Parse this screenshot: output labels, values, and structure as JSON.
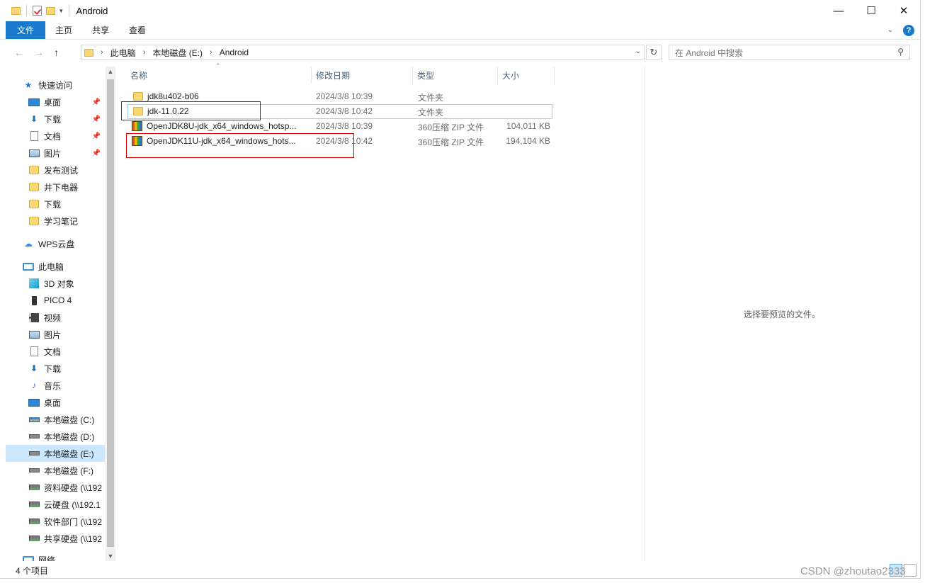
{
  "window": {
    "title": "Android",
    "controls": {
      "minimize": "—",
      "maximize": "☐",
      "close": "✕"
    }
  },
  "ribbon": {
    "tabs": [
      "文件",
      "主页",
      "共享",
      "查看"
    ],
    "help": "?"
  },
  "address": {
    "crumbs": [
      "此电脑",
      "本地磁盘 (E:)",
      "Android"
    ],
    "search_placeholder": "在 Android 中搜索"
  },
  "nav_pane": {
    "items": [
      {
        "label": "快速访问",
        "icon": "star-icon"
      },
      {
        "label": "桌面",
        "icon": "desktop-icon",
        "pinned": true
      },
      {
        "label": "下载",
        "icon": "download-icon",
        "pinned": true
      },
      {
        "label": "文档",
        "icon": "document-icon",
        "pinned": true
      },
      {
        "label": "图片",
        "icon": "picture-icon",
        "pinned": true
      },
      {
        "label": "发布测试",
        "icon": "folder-icon"
      },
      {
        "label": "井下电器",
        "icon": "folder-icon"
      },
      {
        "label": "下载",
        "icon": "folder-icon"
      },
      {
        "label": "学习笔记",
        "icon": "folder-icon"
      },
      {
        "label": "WPS云盘",
        "icon": "cloud-icon"
      },
      {
        "label": "此电脑",
        "icon": "computer-icon"
      },
      {
        "label": "3D 对象",
        "icon": "3d-objects-icon"
      },
      {
        "label": "PICO 4",
        "icon": "phone-icon"
      },
      {
        "label": "视频",
        "icon": "video-icon"
      },
      {
        "label": "图片",
        "icon": "picture-icon"
      },
      {
        "label": "文档",
        "icon": "document-icon"
      },
      {
        "label": "下载",
        "icon": "download-icon"
      },
      {
        "label": "音乐",
        "icon": "music-icon"
      },
      {
        "label": "桌面",
        "icon": "desktop-icon"
      },
      {
        "label": "本地磁盘 (C:)",
        "icon": "system-drive-icon"
      },
      {
        "label": "本地磁盘 (D:)",
        "icon": "drive-icon"
      },
      {
        "label": "本地磁盘 (E:)",
        "icon": "drive-icon",
        "selected": true
      },
      {
        "label": "本地磁盘 (F:)",
        "icon": "drive-icon"
      },
      {
        "label": "资料硬盘 (\\\\192",
        "icon": "network-drive-icon"
      },
      {
        "label": "云硬盘 (\\\\192.1",
        "icon": "network-drive-icon"
      },
      {
        "label": "软件部门 (\\\\192",
        "icon": "network-drive-icon"
      },
      {
        "label": "共享硬盘 (\\\\192",
        "icon": "network-drive-icon"
      },
      {
        "label": "网络",
        "icon": "network-icon"
      }
    ]
  },
  "file_list": {
    "columns": {
      "name": "名称",
      "modified": "修改日期",
      "type": "类型",
      "size": "大小"
    },
    "rows": [
      {
        "name": "jdk8u402-b06",
        "modified": "2024/3/8 10:39",
        "type": "文件夹",
        "size": "",
        "icon": "folder-icon"
      },
      {
        "name": "jdk-11.0.22",
        "modified": "2024/3/8 10:42",
        "type": "文件夹",
        "size": "",
        "icon": "folder-icon"
      },
      {
        "name": "OpenJDK8U-jdk_x64_windows_hotsp...",
        "modified": "2024/3/8 10:39",
        "type": "360压缩 ZIP 文件",
        "size": "104,011 KB",
        "icon": "zip-icon"
      },
      {
        "name": "OpenJDK11U-jdk_x64_windows_hots...",
        "modified": "2024/3/8 10:42",
        "type": "360压缩 ZIP 文件",
        "size": "194,104 KB",
        "icon": "zip-icon"
      }
    ]
  },
  "preview": {
    "message": "选择要预览的文件。"
  },
  "status_bar": {
    "count": "4 个项目"
  },
  "watermark": "CSDN @zhoutao2333",
  "colors": {
    "accent": "#1979ca",
    "selection": "#cce8ff",
    "annotation": "#d40000"
  }
}
